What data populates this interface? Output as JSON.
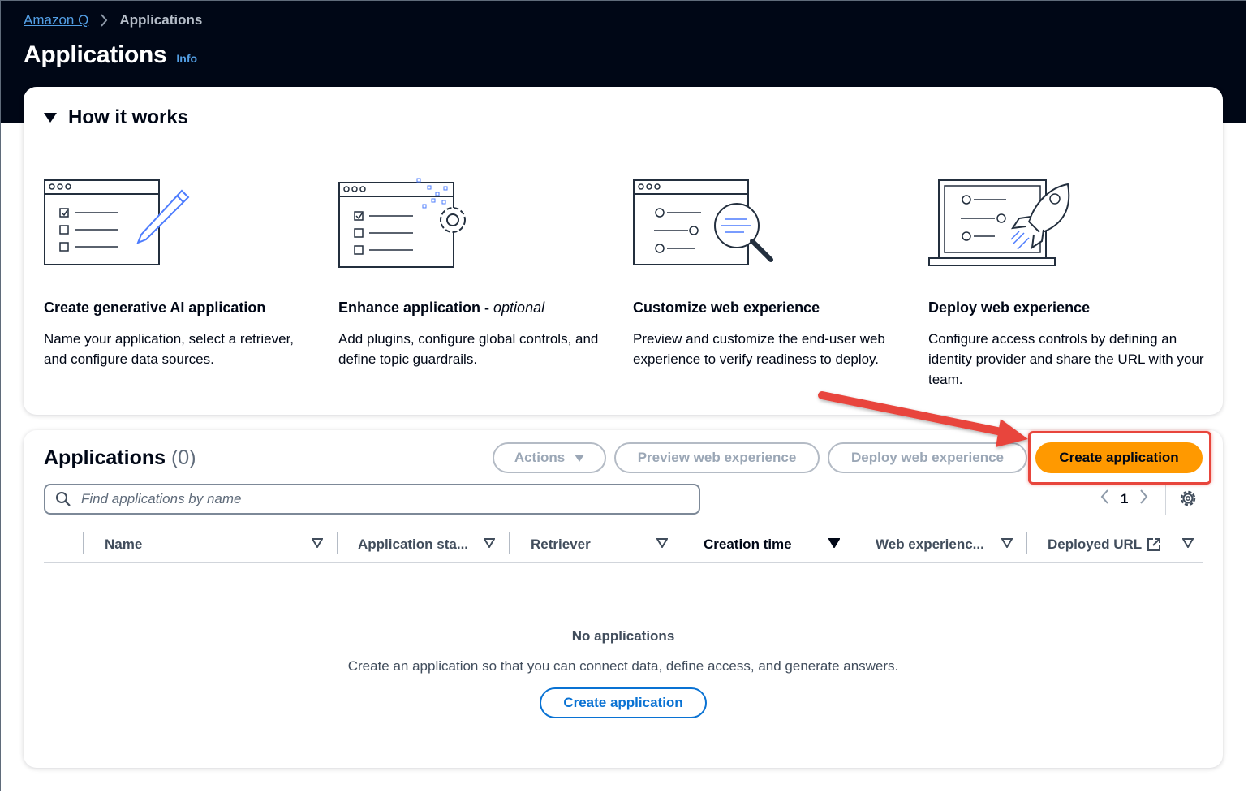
{
  "breadcrumb": {
    "root": "Amazon Q",
    "current": "Applications"
  },
  "page": {
    "title": "Applications",
    "info": "Info"
  },
  "how_it_works": {
    "heading": "How it works",
    "steps": [
      {
        "title": "Create generative AI application",
        "optional": "",
        "description": "Name your application, select a retriever, and configure data sources."
      },
      {
        "title": "Enhance application - ",
        "optional": "optional",
        "description": "Add plugins, configure global controls, and define topic guardrails."
      },
      {
        "title": "Customize web experience",
        "optional": "",
        "description": "Preview and customize the end-user web experience to verify readiness to deploy."
      },
      {
        "title": "Deploy web experience",
        "optional": "",
        "description": "Configure access controls by defining an identity provider and share the URL with your team."
      }
    ]
  },
  "applications": {
    "title": "Applications",
    "count": "(0)",
    "buttons": {
      "actions": "Actions",
      "preview": "Preview web experience",
      "deploy": "Deploy web experience",
      "create": "Create application"
    },
    "search_placeholder": "Find applications by name",
    "page_number": "1",
    "columns": [
      "Name",
      "Application sta...",
      "Retriever",
      "Creation time",
      "Web experienc...",
      "Deployed URL"
    ],
    "empty_title": "No applications",
    "empty_description": "Create an application so that you can connect data, define access, and generate answers.",
    "empty_button": "Create application"
  },
  "colors": {
    "header_bg": "#000716",
    "primary_button": "#ff9900",
    "link": "#539fe5",
    "annotation": "#e8453c"
  }
}
